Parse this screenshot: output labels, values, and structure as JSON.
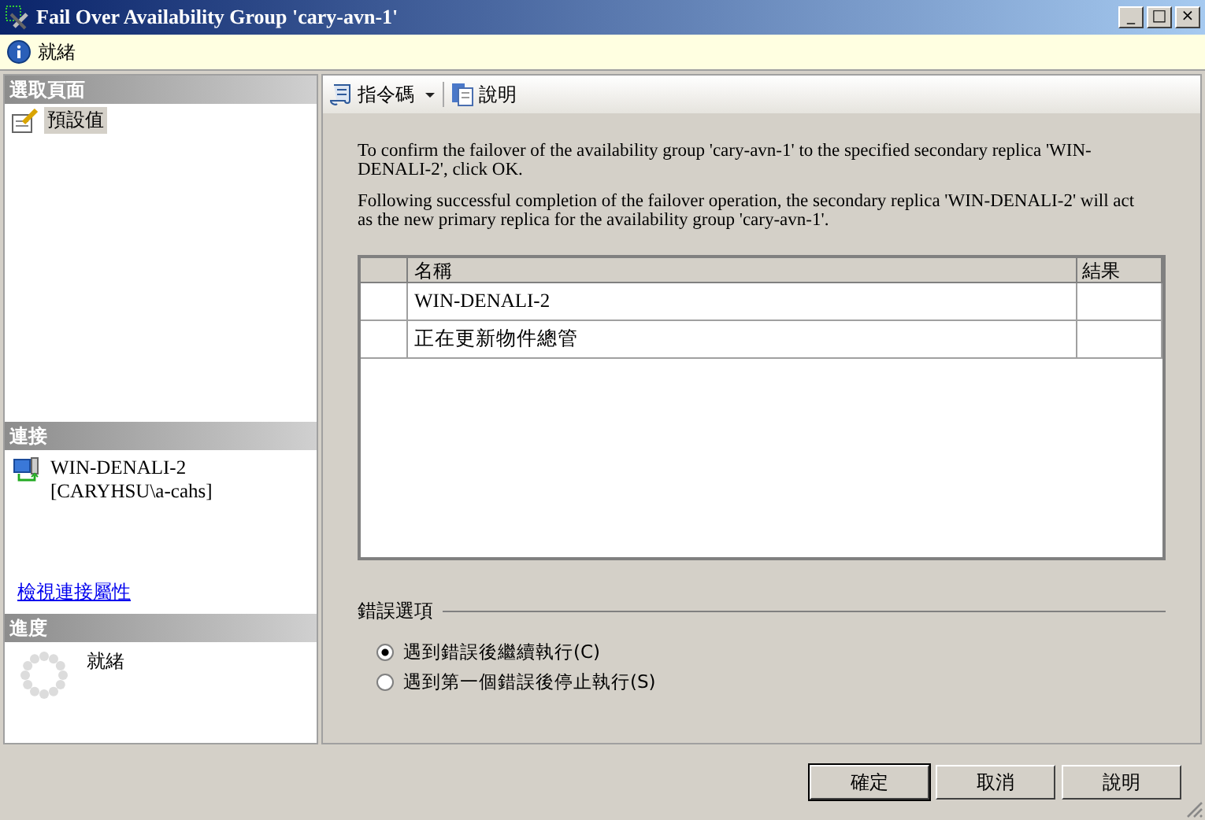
{
  "window": {
    "title": "Fail Over Availability Group 'cary-avn-1'",
    "controls": [
      "_",
      "□",
      "×"
    ]
  },
  "status_bar": {
    "text": "就緒"
  },
  "sidebar": {
    "pages_header": "選取頁面",
    "pages": [
      {
        "label": "預設值",
        "selected": true
      }
    ],
    "connection_header": "連接",
    "connection": {
      "server": "WIN-DENALI-2",
      "user": "[CARYHSU\\a-cahs]"
    },
    "connection_link": "檢視連接屬性",
    "progress_header": "進度",
    "progress_status": "就緒"
  },
  "toolbar": [
    {
      "kind": "script",
      "label": "指令碼",
      "dropdown": true
    },
    {
      "kind": "help",
      "label": "說明",
      "dropdown": false
    }
  ],
  "message": [
    "To confirm the failover of the availability group 'cary-avn-1' to the specified secondary replica 'WIN-DENALI-2', click OK.",
    "Following successful completion of the failover operation, the secondary replica 'WIN-DENALI-2' will act as the new primary replica for the availability group 'cary-avn-1'."
  ],
  "table": {
    "columns": [
      "名稱",
      "結果"
    ],
    "rows": [
      {
        "name": "WIN-DENALI-2"
      },
      {
        "name": "正在更新物件總管"
      }
    ]
  },
  "error_options": {
    "title": "錯誤選項",
    "options": [
      {
        "label": "遇到錯誤後繼續執行(C)",
        "selected": true
      },
      {
        "label": "遇到第一個錯誤後停止執行(S)",
        "selected": false
      }
    ]
  },
  "buttons": [
    {
      "label": "確定",
      "default": true
    },
    {
      "label": "取消",
      "default": false
    },
    {
      "label": "說明",
      "default": false
    }
  ]
}
